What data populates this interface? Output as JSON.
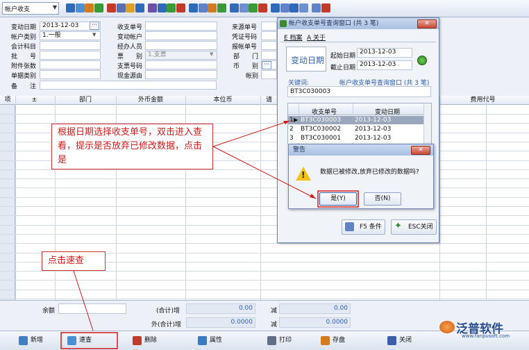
{
  "toolbar": {
    "combo_value": "帐户收支"
  },
  "form": {
    "fields": [
      {
        "label": "变动日期",
        "value": "2013-12-03"
      },
      {
        "label": "帐户类别",
        "value": "1.一般"
      },
      {
        "label": "会计科目",
        "value": ""
      },
      {
        "label": "批　　号",
        "value": ""
      },
      {
        "label": "附件张数",
        "value": ""
      },
      {
        "label": "单据类别",
        "value": ""
      },
      {
        "label": "备　　注",
        "value": ""
      }
    ],
    "fields_mid": [
      {
        "label": "收支单号",
        "value": ""
      },
      {
        "label": "变动帐户",
        "value": ""
      },
      {
        "label": "经办人员",
        "value": ""
      },
      {
        "label": "票　　别",
        "value": "1.支票"
      },
      {
        "label": "支票号码",
        "value": ""
      },
      {
        "label": "现金源由",
        "value": ""
      }
    ],
    "fields_right": [
      {
        "label": "来源单号"
      },
      {
        "label": "凭证号码"
      },
      {
        "label": "报帐单号"
      },
      {
        "label": "部　　门"
      },
      {
        "label": "币　　别"
      },
      {
        "label": "帐别"
      }
    ]
  },
  "grid": {
    "headers": [
      "项",
      "±",
      "部门",
      "外币金额",
      "本位币",
      "请",
      "费用代号"
    ]
  },
  "footer": {
    "balance_label": "余额",
    "total_local_label": "(合计)增",
    "total_local_value": "0.00",
    "minus1": "减",
    "minus1_value": "0.00",
    "total_foreign_label": "外(合计)增",
    "total_foreign_value": "0.0000",
    "minus2": "减",
    "minus2_value": "0.0000"
  },
  "bottom_buttons": [
    "新增",
    "速查",
    "删除",
    "属性",
    "打印",
    "存盘",
    "关闭"
  ],
  "query_window": {
    "title": "帐户收支单号查询窗口 (共 3 笔)",
    "menu": [
      "E 档案",
      "A 关于"
    ],
    "date_section": "变动日期",
    "start_label": "起始日期",
    "start_value": "2013-12-03",
    "end_label": "截止日期",
    "end_value": "2013-12-03",
    "keyword_label": "关键词:",
    "keyword_info": "帐户收支单号查询窗口 (共 3 笔)",
    "keyword_value": "BT3C030003",
    "columns": [
      "收支单号",
      "变动日期"
    ],
    "rows": [
      {
        "no": "1",
        "id": "BT3C030003",
        "date": "2013-12-03"
      },
      {
        "no": "2",
        "id": "BT3C030002",
        "date": "2013-12-03"
      },
      {
        "no": "3",
        "id": "BT3C030001",
        "date": "2013-12-03"
      }
    ],
    "f5_label": "F5 条件",
    "esc_label": "ESC关闭"
  },
  "alert": {
    "title": "警告",
    "message": "数据已被修改,放弃已修改的数据吗?",
    "yes": "是(Y)",
    "no": "否(N)"
  },
  "callouts": {
    "main": "根据日期选择收支单号，双击进入查看，提示是否放弃已修改数据，点击是",
    "quick": "点击速查"
  },
  "logo": {
    "name": "泛普软件",
    "url": "www.fanpusoft.com"
  },
  "colors": {
    "accent": "#2f5fa8",
    "callout": "#d01818",
    "selection": "#3d5aa0"
  }
}
